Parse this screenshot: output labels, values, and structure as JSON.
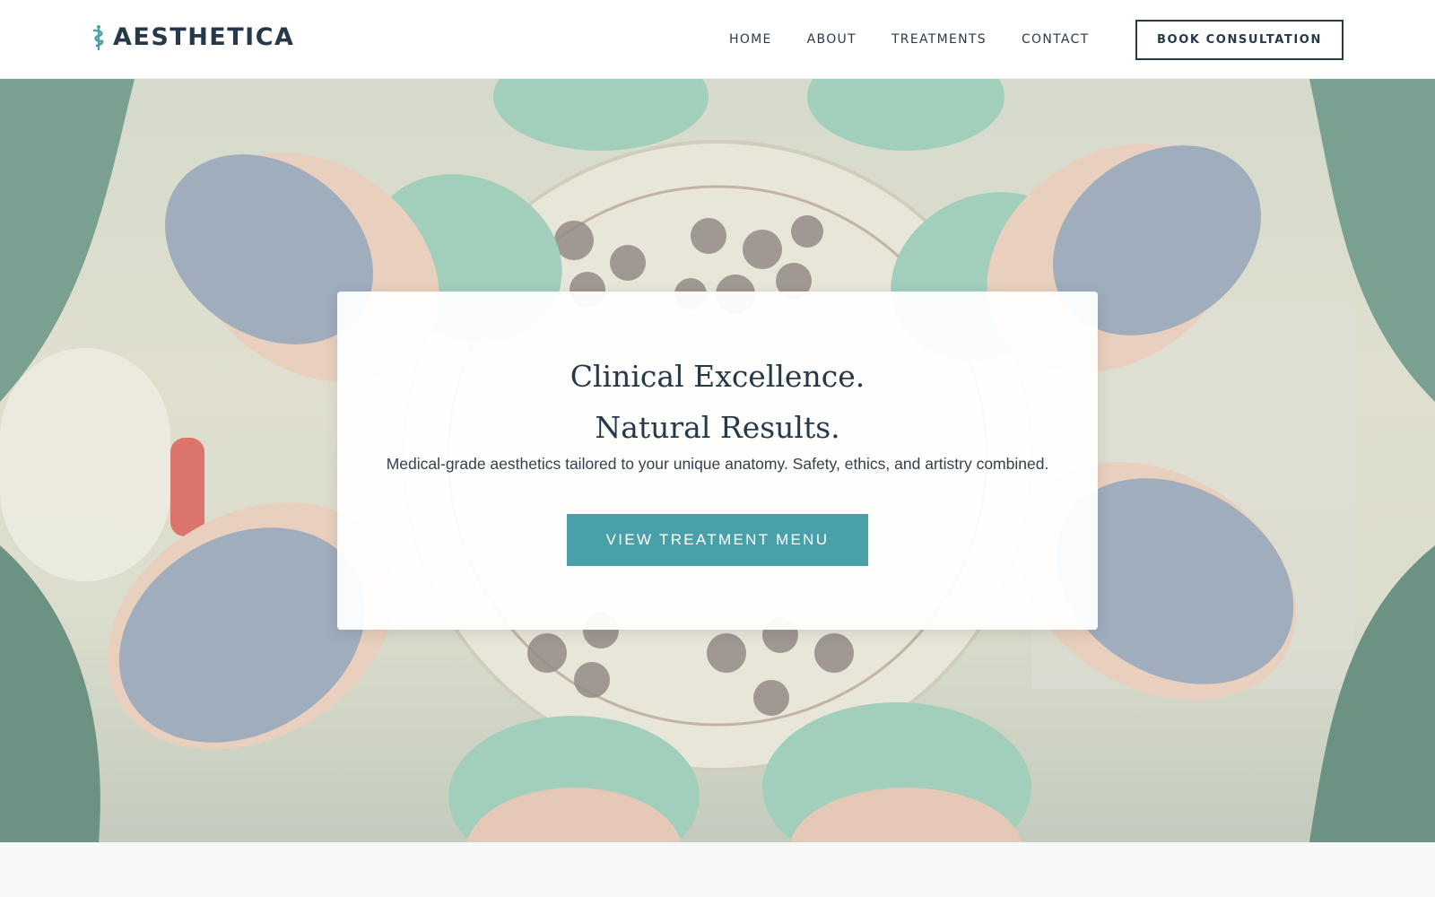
{
  "header": {
    "brand": "AESTHETICA",
    "brand_icon": "caduceus-icon",
    "nav": [
      "HOME",
      "ABOUT",
      "TREATMENTS",
      "CONTACT"
    ],
    "cta_label": "BOOK CONSULTATION"
  },
  "hero": {
    "title_line1": "Clinical Excellence.",
    "title_line2": "Natural Results.",
    "subtitle": "Medical-grade aesthetics tailored to your unique anatomy. Safety, ethics, and artistry combined.",
    "button_label": "VIEW TREATMENT MENU",
    "image_description": ""
  },
  "colors": {
    "accent": "#4aa0a8",
    "brand_dark": "#26394a",
    "scrub_green": "#8fc9b4",
    "mask_blue": "#8e9fb5"
  }
}
